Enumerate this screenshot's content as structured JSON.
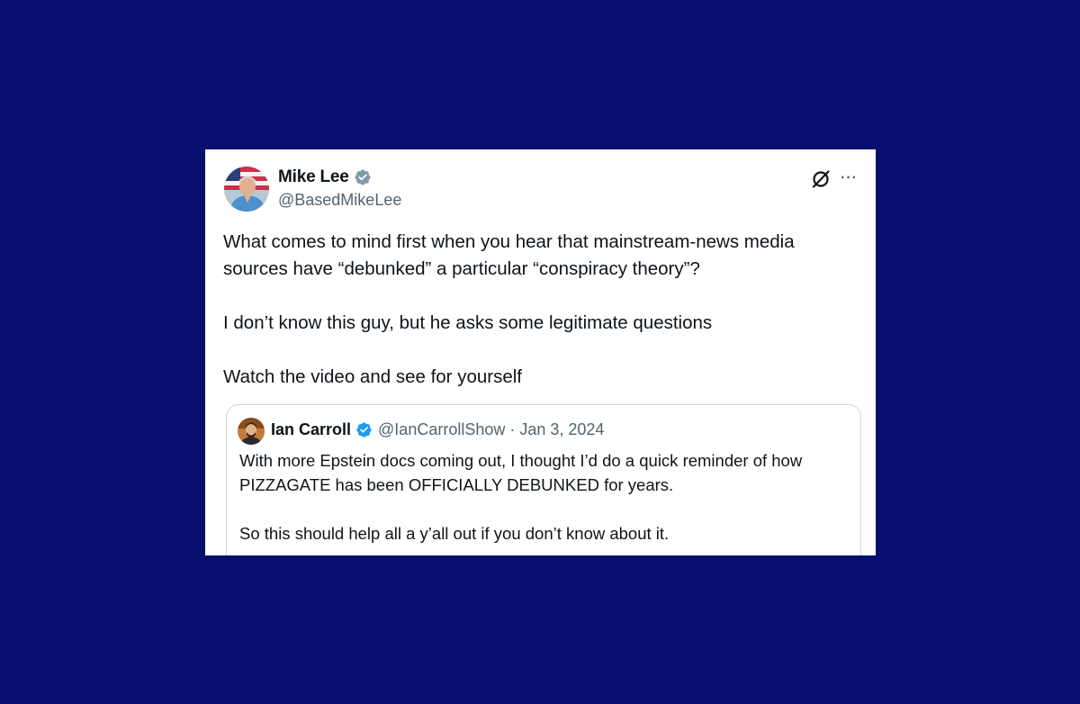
{
  "colors": {
    "page_background": "#07106e",
    "card_background": "#ffffff",
    "verified_blue": "#1d9bf0",
    "verified_gray": "#829aab",
    "text_primary": "#0f1419",
    "text_secondary": "#536471"
  },
  "tweet": {
    "author": {
      "name": "Mike Lee",
      "handle": "@BasedMikeLee",
      "badge": "verified-gray-badge-icon"
    },
    "actions": {
      "grok_icon": "grok-icon",
      "more_icon": "more-options-icon",
      "more_glyph": "···"
    },
    "body": {
      "line1": "What comes to mind first when you hear that mainstream-news media sources have “debunked” a particular “conspiracy theory”?",
      "line2": "I don’t know this guy, but he asks some legitimate questions",
      "line3": "Watch the video and see for yourself"
    },
    "quoted": {
      "author": {
        "name": "Ian Carroll",
        "handle": "@IanCarrollShow",
        "separator": "·",
        "date": "Jan 3, 2024",
        "badge": "verified-blue-badge-icon"
      },
      "body": {
        "line1": "With more Epstein docs coming out, I thought I’d do a quick reminder of how PIZZAGATE has been OFFICIALLY DEBUNKED for years.",
        "line2": "So this should help all a y’all out if you don’t know about it."
      }
    }
  }
}
